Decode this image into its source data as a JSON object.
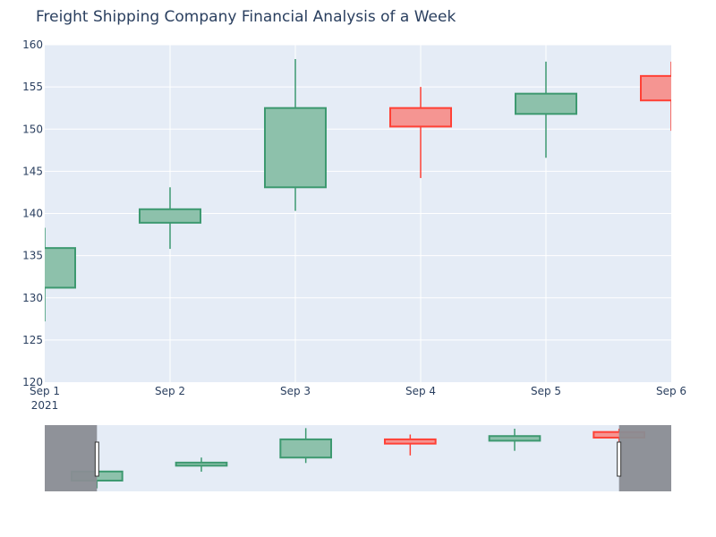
{
  "chart_data": {
    "type": "candlestick",
    "title": "Freight Shipping Company Financial Analysis of a Week",
    "x": [
      "2021-09-01",
      "2021-09-02",
      "2021-09-03",
      "2021-09-04",
      "2021-09-05",
      "2021-09-06"
    ],
    "x_tick_labels": [
      "Sep 1",
      "Sep 2",
      "Sep 3",
      "Sep 4",
      "Sep 5",
      "Sep 6"
    ],
    "x_year_label": "2021",
    "y_tick_labels": [
      "120",
      "125",
      "130",
      "135",
      "140",
      "145",
      "150",
      "155",
      "160"
    ],
    "ylim": [
      120,
      160
    ],
    "open": [
      131.2,
      138.9,
      143.1,
      152.5,
      151.8,
      156.3
    ],
    "high": [
      138.3,
      143.1,
      158.3,
      155.0,
      158.0,
      158.0
    ],
    "low": [
      127.2,
      135.8,
      140.3,
      144.2,
      146.6,
      149.8
    ],
    "close": [
      135.9,
      140.5,
      152.5,
      150.3,
      154.2,
      153.4
    ],
    "grid": true,
    "rangeslider": true,
    "colors": {
      "increasing": "#3d9970",
      "increasing_fill": "#8dc1ab",
      "decreasing": "#ff4136",
      "decreasing_fill": "#f59592",
      "plot_bg": "#e5ecf6",
      "grid": "#ffffff",
      "text": "#2a3f5f",
      "range_mask": "#8a8d93"
    }
  }
}
